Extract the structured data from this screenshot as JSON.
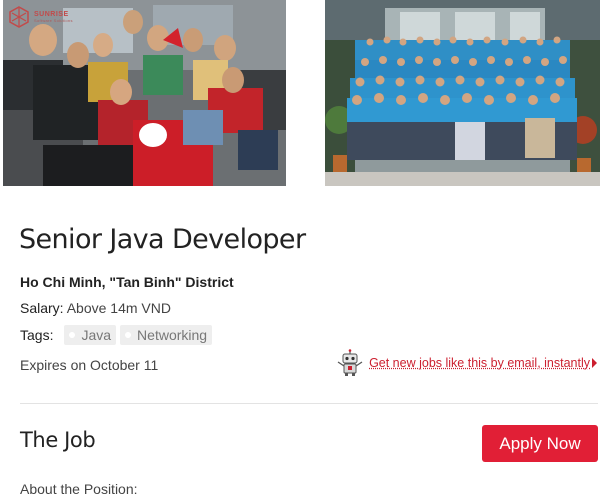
{
  "brand": {
    "logo_text": "SUNRISE",
    "logo_subtext": "Software Solutions",
    "logo_color": "#c24a4a"
  },
  "photos": [
    {
      "name": "office-holiday-team-photo"
    },
    {
      "name": "company-group-photo"
    }
  ],
  "job": {
    "title": "Senior Java Developer",
    "location": "Ho Chi Minh, \"Tan Binh\" District",
    "salary_label": "Salary:",
    "salary_value": "Above 14m VND",
    "tags_label": "Tags:",
    "tags": [
      "Java",
      "Networking"
    ],
    "expires": "Expires on October 11"
  },
  "subscribe": {
    "icon": "robot-icon",
    "link_text": "Get new jobs like this by email, instantly"
  },
  "section": {
    "title": "The Job",
    "apply_label": "Apply Now",
    "subheading": "About the Position:"
  },
  "colors": {
    "accent": "#e11f36",
    "link": "#cc1f2f",
    "tag_bg": "#eeeeee",
    "divider": "#e3e3e3"
  }
}
